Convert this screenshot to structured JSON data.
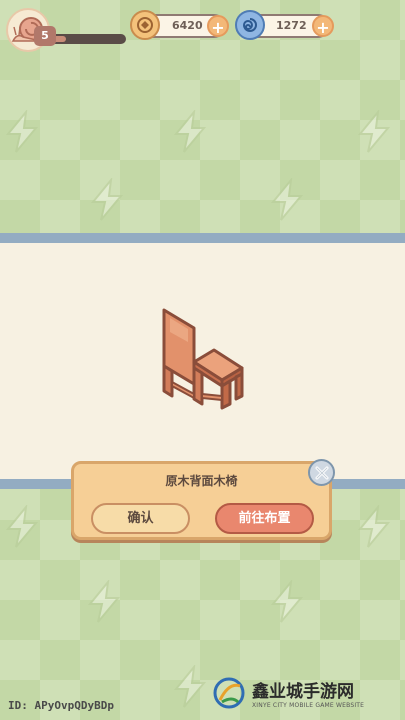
{
  "hud": {
    "level": "5",
    "xp_fraction": 0.2,
    "coins": "6420",
    "gems": "1272",
    "coin_icon": "coin-icon",
    "gem_icon": "swirl-gem-icon",
    "add_icon": "plus-icon"
  },
  "item": {
    "name": "原木背面木椅",
    "icon": "wooden-chair-icon"
  },
  "dialog": {
    "confirm_label": "确认",
    "goto_label": "前往布置",
    "close_icon": "close-icon"
  },
  "footer": {
    "id_text": "ID: APyOvpQDyBDp"
  },
  "watermark": {
    "title": "鑫业城手游网",
    "subtitle": "XINYE CITY MOBILE GAME WEBSITE"
  },
  "colors": {
    "background": "#cfe0b6",
    "band": "#f7f1e2",
    "stripe": "#93acc2",
    "dialog": "#f6cf96",
    "goto_button": "#e9876e"
  }
}
